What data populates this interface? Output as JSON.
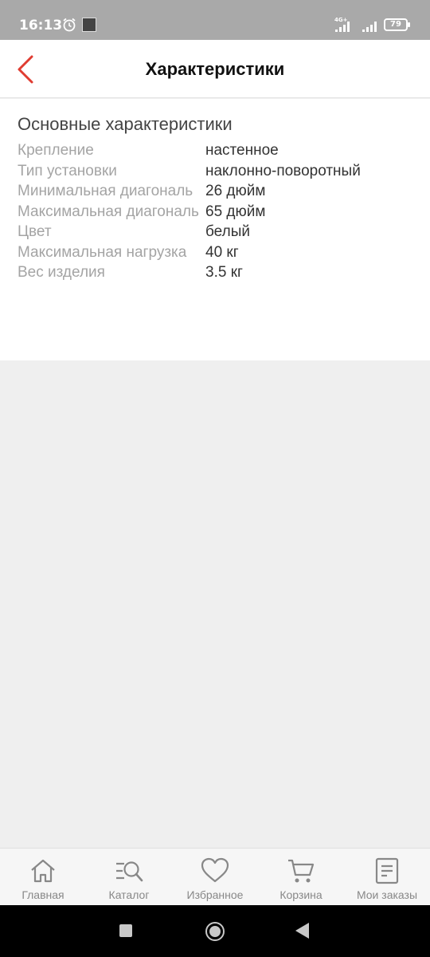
{
  "status_bar": {
    "time": "16:13",
    "network": "4G+",
    "battery": "79"
  },
  "header": {
    "title": "Характеристики"
  },
  "section": {
    "title": "Основные характеристики",
    "specs": [
      {
        "label": "Крепление",
        "value": "настенное"
      },
      {
        "label": "Тип установки",
        "value": "наклонно-поворотный"
      },
      {
        "label": "Минимальная диагональ",
        "value": "26 дюйм"
      },
      {
        "label": "Максимальная диагональ",
        "value": "65 дюйм"
      },
      {
        "label": "Цвет",
        "value": "белый"
      },
      {
        "label": "Максимальная нагрузка",
        "value": "40 кг"
      },
      {
        "label": "Вес изделия",
        "value": "3.5 кг"
      }
    ]
  },
  "bottom_nav": {
    "items": [
      {
        "label": "Главная",
        "icon": "home-icon"
      },
      {
        "label": "Каталог",
        "icon": "catalog-icon"
      },
      {
        "label": "Избранное",
        "icon": "heart-icon"
      },
      {
        "label": "Корзина",
        "icon": "cart-icon"
      },
      {
        "label": "Мои заказы",
        "icon": "orders-icon"
      }
    ]
  },
  "colors": {
    "accent": "#e03c31",
    "nav_gray": "#888888",
    "label_gray": "#a4a4a4"
  }
}
